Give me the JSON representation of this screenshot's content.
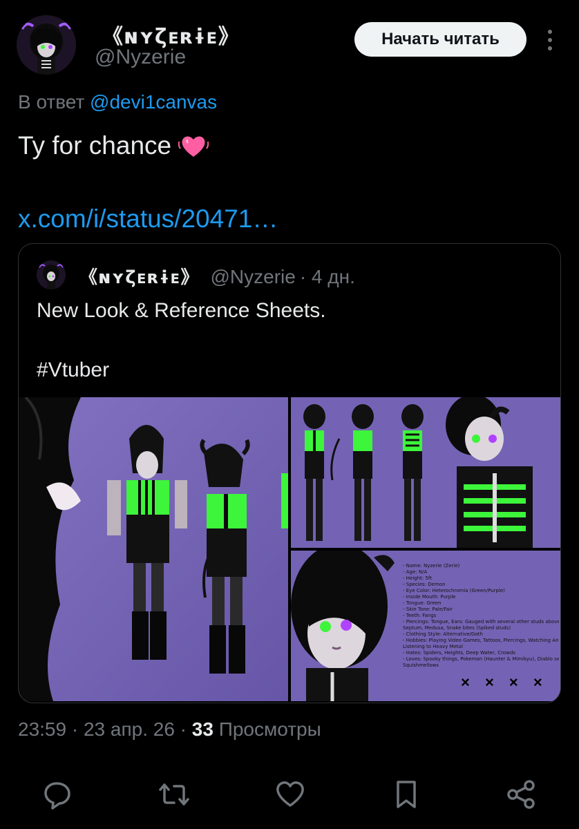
{
  "header": {
    "display_name": "《ɴʏζᴇʀɨᴇ》",
    "handle": "@Nyzerie",
    "follow_label": "Начать читать",
    "more_icon": "more-vertical-icon"
  },
  "reply": {
    "prefix": "В ответ",
    "mention": "@devi1canvas"
  },
  "tweet": {
    "text": "Ty for chance",
    "emoji": "beating-heart-emoji",
    "link": "x.com/i/status/20471…"
  },
  "quote": {
    "display_name": "《ɴʏζᴇʀɨᴇ》",
    "handle": "@Nyzerie",
    "time": "· 4 дн.",
    "text_line1": "New Look & Reference Sheets.",
    "text_line2": "#Vtuber",
    "reference_sheet": [
      "- Name: Nyzerie (Zerie)",
      "- Age: N/A",
      "- Height: 5ft",
      "- Species: Demon",
      "- Eye Color: Heterochromia (Green/Purple)",
      "- Inside Mouth: Purple",
      "- Tongue: Green",
      "- Skin Tone: Pale/Fair",
      "- Teeth: Fangs",
      "- Piercings: Tongue, Ears: Gauged with several other studs above, B",
      "Septum, Medusa, Snake bites (Spiked studs)",
      "- Clothing Style: Alternative/Goth",
      "- Hobbies: Playing Video Games, Tattoos, Piercings, Watching Anim",
      "Listening to Heavy Metal",
      "- Hates: Spiders, Heights, Deep Water, Crowds",
      "- Loves: Spooky things, Pokemon (Haunter & Mimikyu), Diablo serie",
      "Squishmellows"
    ],
    "reference_marks": "× × × ×"
  },
  "meta": {
    "time": "23:59",
    "sep1": " · ",
    "date": "23 апр. 26",
    "sep2": " · ",
    "views_count": "33",
    "views_label": " Просмотры"
  },
  "actions": [
    "reply-icon",
    "repost-icon",
    "like-icon",
    "bookmark-icon",
    "share-icon"
  ],
  "colors": {
    "background": "#000000",
    "text": "#e7e9ea",
    "muted": "#71767b",
    "link": "#1d9bf0",
    "button_bg": "#eff3f4",
    "media_purple": "#6a5aa8",
    "accent_green": "#3df53a"
  }
}
